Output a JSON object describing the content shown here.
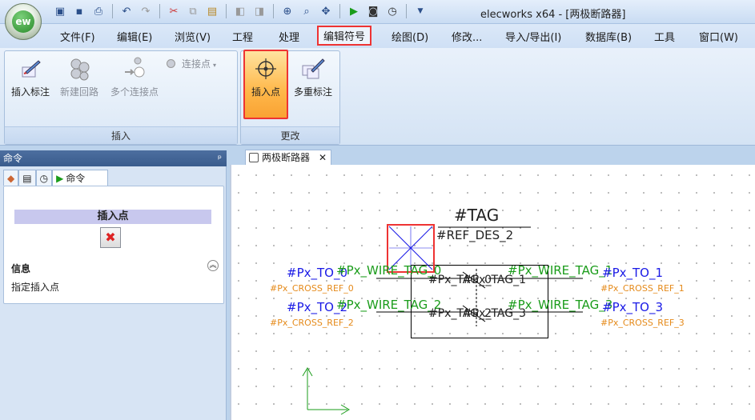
{
  "app": {
    "logo_text": "ew",
    "title": "elecworks x64 - [两极断路器]"
  },
  "menu": [
    "文件(F)",
    "编辑(E)",
    "浏览(V)",
    "工程",
    "处理",
    "编辑符号",
    "绘图(D)",
    "修改...",
    "导入/导出(I)",
    "数据库(B)",
    "工具",
    "窗口(W)"
  ],
  "ribbon": {
    "insert_group": {
      "label": "插入",
      "buttons": [
        "插入标注",
        "新建回路",
        "多个连接点"
      ],
      "dropdown": "连接点"
    },
    "modify_group": {
      "label": "更改",
      "buttons": [
        "插入点",
        "多重标注"
      ]
    }
  },
  "left_panel": {
    "header": "命令",
    "pin": "ᵖ",
    "tab_label": "命令",
    "command_title": "插入点",
    "info_label": "信息",
    "info_text": "指定插入点"
  },
  "doc_tab": {
    "label": "两极断路器",
    "close": "✕"
  },
  "symbol": {
    "tag": "#TAG",
    "ref_des": "#REF_DES_2",
    "left": [
      {
        "to": "#Px_TO_0",
        "wire": "#Px_WIRE_TAG_0",
        "cross": "#Px_CROSS_REF_0"
      },
      {
        "to": "#Px_TO_2",
        "wire": "#Px_WIRE_TAG_2",
        "cross": "#Px_CROSS_REF_2"
      }
    ],
    "right": [
      {
        "to": "#Px_TO_1",
        "wire": "#Px_WIRE_TAG_1",
        "cross": "#Px_CROSS_REF_1"
      },
      {
        "to": "#Px_TO_3",
        "wire": "#Px_WIRE_TAG_3",
        "cross": "#Px_CROSS_REF_3"
      }
    ],
    "inner": [
      "#Px_TAG_0",
      "#Px_TAG_1",
      "#Px_TAG_2",
      "#Px_TAG_3"
    ]
  }
}
